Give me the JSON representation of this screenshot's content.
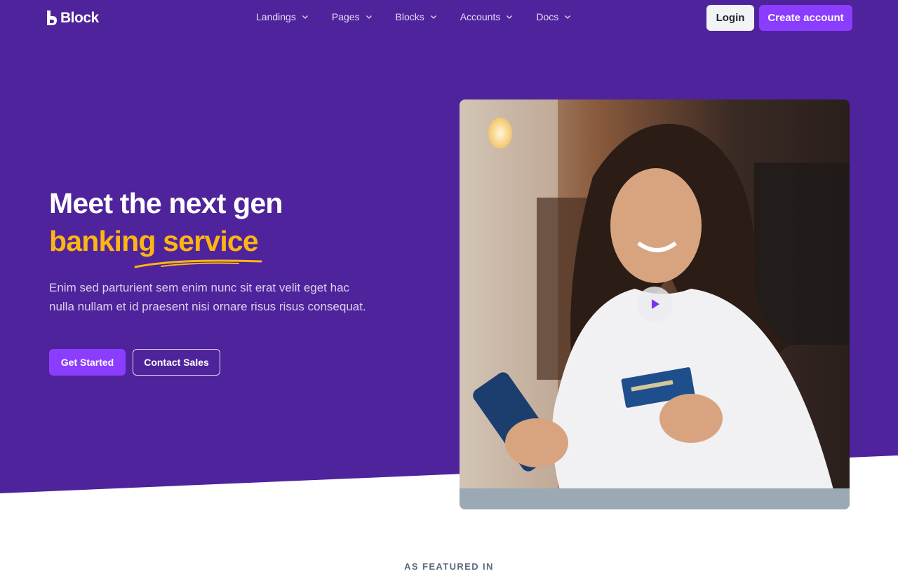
{
  "brand": {
    "name": "Block"
  },
  "nav": {
    "items": [
      {
        "label": "Landings"
      },
      {
        "label": "Pages"
      },
      {
        "label": "Blocks"
      },
      {
        "label": "Accounts"
      },
      {
        "label": "Docs"
      }
    ],
    "login_label": "Login",
    "create_account_label": "Create account"
  },
  "hero": {
    "title_line1": "Meet the next gen",
    "title_accent": "banking service",
    "subtitle": "Enim sed parturient sem enim nunc sit erat velit eget hac nulla nullam et id praesent nisi ornare risus risus consequat.",
    "primary_cta": "Get Started",
    "secondary_cta": "Contact Sales"
  },
  "featured": {
    "label": "AS FEATURED IN"
  },
  "colors": {
    "hero_bg": "#4f239b",
    "accent": "#fdb515",
    "primary_button": "#8b3dff"
  }
}
